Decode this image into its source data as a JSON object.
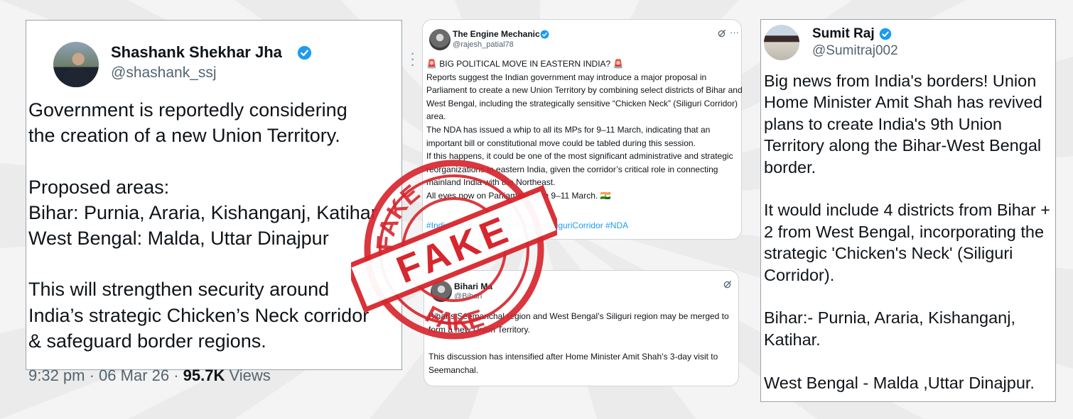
{
  "colors": {
    "verified": "#1d9bf0",
    "stamp": "#d7262e",
    "link": "#1d9bf0",
    "muted": "#536471"
  },
  "post1": {
    "name": "Shashank Shekhar Jha",
    "handle": "@shashank_ssj",
    "more_icon": "more-icon",
    "body": "Government is reportedly considering\nthe creation of a new Union Territory.\n\nProposed areas:\nBihar: Purnia, Araria, Kishanganj, Katihar\nWest Bengal: Malda, Uttar Dinajpur\n\nThis will strengthen security around\nIndia’s strategic Chicken’s Neck corridor\n& safeguard border regions.",
    "time": "9:32 pm · 06 Mar 26 · ",
    "views_count": "95.7K",
    "views_label": " Views"
  },
  "post2": {
    "name": "The Engine Mechanic",
    "handle": "@rajesh_patial78",
    "body": "🚨 BIG POLITICAL MOVE IN EASTERN INDIA? 🚨\nReports suggest the Indian government may introduce a major proposal in Parliament to create a new Union Territory by combining select districts of Bihar and West Bengal, including the strategically sensitive “Chicken Neck” (Siliguri Corridor) area.\nThe NDA has issued a whip to all its MPs for 9–11 March, indicating that an important bill or constitutional move could be tabled during this session.\nIf this happens, it could be one of the most significant administrative and strategic reorganizations in eastern India, given the corridor’s critical role in connecting mainland India with the Northeast.\nAll eyes now on Parliament from 9–11 March. 🇮🇳",
    "hashtags": "#India #Siliguri #ChickenNeck #SiliguriCorridor #NDA"
  },
  "post3": {
    "name": "Bihari Ma",
    "handle": "@Bihari",
    "body": "Bihar’s Seemanchal region and West Bengal’s Siliguri region may be merged to form a new Union Territory.\n\nThis discussion has intensified after Home Minister Amit Shah’s 3-day visit to Seemanchal."
  },
  "post4": {
    "name": "Sumit Raj",
    "handle": "@Sumitraj002",
    "body": "Big news from India's borders! Union Home Minister Amit Shah has revived plans to create India's 9th Union Territory along the Bihar-West Bengal border.\n\nIt would include 4 districts from Bihar + 2 from West Bengal, incorporating the strategic 'Chicken's Neck' (Siliguri Corridor).\n\nBihar:- Purnia, Araria, Kishanganj, Katihar.\n\nWest Bengal - Malda ,Uttar Dinajpur."
  },
  "stamp": {
    "center": "FAKE",
    "top": "FAKE",
    "bottom": "FAKE"
  },
  "icons": {
    "verified": "verified-badge-icon",
    "grok": "grok-icon"
  }
}
